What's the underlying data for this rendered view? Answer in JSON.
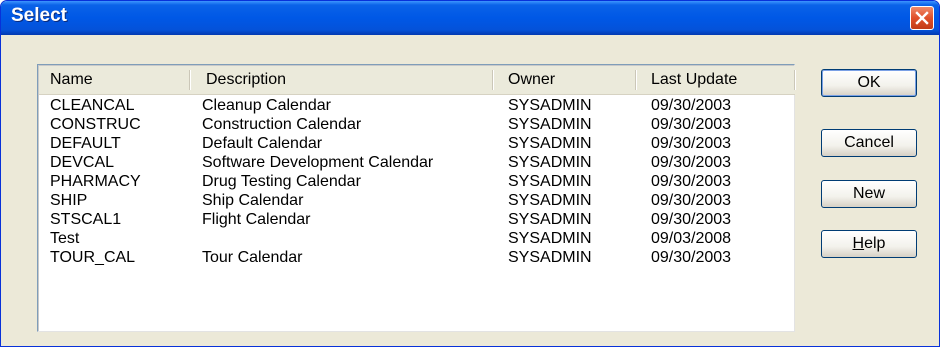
{
  "window": {
    "title": "Select"
  },
  "columns": [
    "Name",
    "Description",
    "Owner",
    "Last Update"
  ],
  "rows": [
    {
      "name": "CLEANCAL",
      "description": "Cleanup Calendar",
      "owner": "SYSADMIN",
      "last_update": "09/30/2003"
    },
    {
      "name": "CONSTRUC",
      "description": "Construction Calendar",
      "owner": "SYSADMIN",
      "last_update": "09/30/2003"
    },
    {
      "name": "DEFAULT",
      "description": "Default Calendar",
      "owner": "SYSADMIN",
      "last_update": "09/30/2003"
    },
    {
      "name": "DEVCAL",
      "description": "Software Development Calendar",
      "owner": "SYSADMIN",
      "last_update": "09/30/2003"
    },
    {
      "name": "PHARMACY",
      "description": "Drug Testing Calendar",
      "owner": "SYSADMIN",
      "last_update": "09/30/2003"
    },
    {
      "name": "SHIP",
      "description": "Ship Calendar",
      "owner": "SYSADMIN",
      "last_update": "09/30/2003"
    },
    {
      "name": "STSCAL1",
      "description": "Flight Calendar",
      "owner": "SYSADMIN",
      "last_update": "09/30/2003"
    },
    {
      "name": "Test",
      "description": "",
      "owner": "SYSADMIN",
      "last_update": "09/03/2008"
    },
    {
      "name": "TOUR_CAL",
      "description": "Tour Calendar",
      "owner": "SYSADMIN",
      "last_update": "09/30/2003"
    }
  ],
  "buttons": {
    "ok": "OK",
    "cancel": "Cancel",
    "new": "New",
    "help": {
      "mnemonic": "H",
      "rest": "elp"
    }
  },
  "icons": {
    "close": "close-icon"
  },
  "colors": {
    "titlebar": "#0058e6",
    "dialog_bg": "#ece9d8",
    "close_button": "#e0502a",
    "list_bg": "#ffffff",
    "header_bg": "#ebeadb"
  }
}
